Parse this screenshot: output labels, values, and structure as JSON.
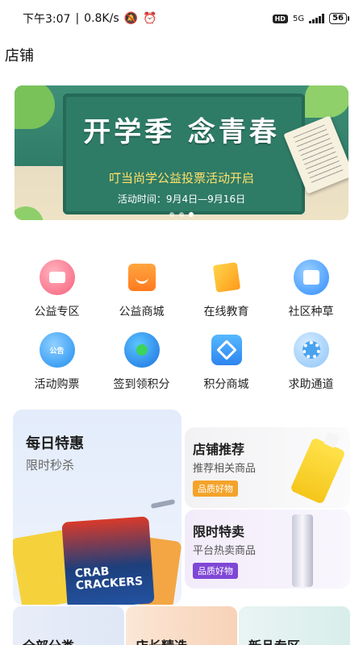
{
  "status_bar": {
    "time": "下午3:07",
    "net_speed": "0.8K/s",
    "hd": "HD",
    "network": "5G",
    "battery": "56"
  },
  "page": {
    "title": "店铺"
  },
  "banner": {
    "title": "开学季 念青春",
    "subtitle": "叮当尚学公益投票活动开启",
    "date_line": "活动时间：9月4日—9月16日",
    "dots": 3,
    "active_dot": 2
  },
  "menu": [
    {
      "label": "公益专区",
      "icon": "charity-heart-icon"
    },
    {
      "label": "公益商城",
      "icon": "shopping-bag-icon"
    },
    {
      "label": "在线教育",
      "icon": "book-icon"
    },
    {
      "label": "社区种草",
      "icon": "calendar-check-icon"
    },
    {
      "label": "活动购票",
      "icon": "ticket-notice-icon",
      "icon_text": "公告"
    },
    {
      "label": "签到领积分",
      "icon": "chat-checkin-icon"
    },
    {
      "label": "积分商城",
      "icon": "layers-icon"
    },
    {
      "label": "求助通道",
      "icon": "gear-help-icon"
    }
  ],
  "promo": {
    "daily": {
      "title": "每日特惠",
      "subtitle": "限时秒杀",
      "snack_text": "CRAB CRACKERS"
    },
    "store": {
      "title": "店铺推荐",
      "subtitle": "推荐相关商品",
      "badge": "品质好物"
    },
    "limited": {
      "title": "限时特卖",
      "subtitle": "平台热卖商品",
      "badge": "品质好物"
    }
  },
  "bottom_cards": [
    {
      "title": "全部分类"
    },
    {
      "title": "店长精选"
    },
    {
      "title": "新品专区"
    }
  ],
  "colors": {
    "banner_green": "#2f7c68",
    "banner_yellow_text": "#ffe26a",
    "badge_orange": "#f3a32a",
    "badge_purple": "#7f47d6"
  }
}
